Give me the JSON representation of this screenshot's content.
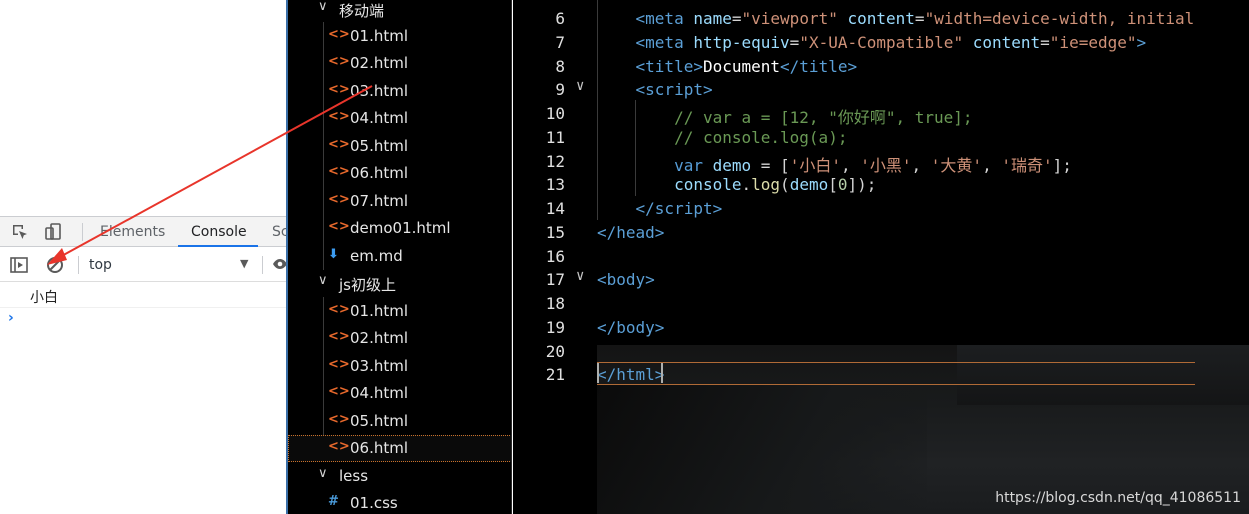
{
  "devtools": {
    "tabs": [
      "Elements",
      "Console",
      "Sc"
    ],
    "active_tab": "Console",
    "context": "top",
    "console_output": "小白",
    "prompt": "›"
  },
  "explorer": {
    "rows": [
      {
        "kind": "folder",
        "label": "移动端"
      },
      {
        "kind": "html",
        "label": "01.html"
      },
      {
        "kind": "html",
        "label": "02.html"
      },
      {
        "kind": "html",
        "label": "03.html"
      },
      {
        "kind": "html",
        "label": "04.html"
      },
      {
        "kind": "html",
        "label": "05.html"
      },
      {
        "kind": "html",
        "label": "06.html"
      },
      {
        "kind": "html",
        "label": "07.html"
      },
      {
        "kind": "html",
        "label": "demo01.html"
      },
      {
        "kind": "md",
        "label": "em.md"
      },
      {
        "kind": "folder",
        "label": "js初级上"
      },
      {
        "kind": "html",
        "label": "01.html"
      },
      {
        "kind": "html",
        "label": "02.html"
      },
      {
        "kind": "html",
        "label": "03.html"
      },
      {
        "kind": "html",
        "label": "04.html"
      },
      {
        "kind": "html",
        "label": "05.html"
      },
      {
        "kind": "html",
        "label": "06.html",
        "selected": true
      },
      {
        "kind": "folder",
        "label": "less"
      },
      {
        "kind": "css",
        "label": "01.css"
      }
    ]
  },
  "editor": {
    "line_numbers": [
      "6",
      "7",
      "8",
      "9",
      "10",
      "11",
      "12",
      "13",
      "14",
      "15",
      "16",
      "17",
      "18",
      "19",
      "20",
      "21"
    ],
    "watermark": "https://blog.csdn.net/qq_41086511"
  }
}
